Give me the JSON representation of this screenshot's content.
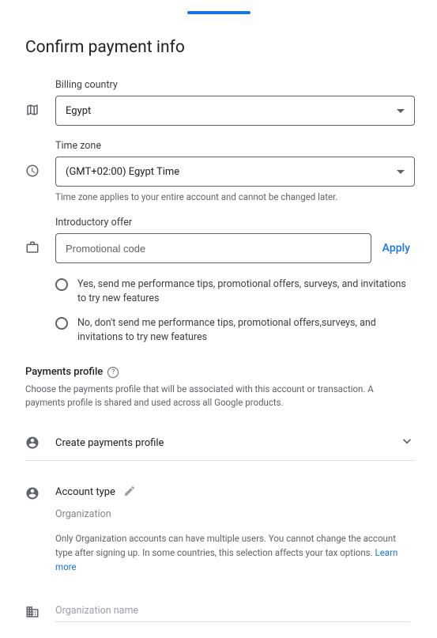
{
  "page": {
    "title": "Confirm payment info"
  },
  "billing": {
    "label": "Billing country",
    "value": "Egypt"
  },
  "timezone": {
    "label": "Time zone",
    "value": "(GMT+02:00) Egypt Time",
    "helper": "Time zone applies to your entire account and cannot be changed later."
  },
  "offer": {
    "label": "Introductory offer",
    "placeholder": "Promotional code",
    "apply": "Apply"
  },
  "radios": {
    "yes": "Yes, send me performance tips, promotional offers, surveys, and invitations to try new features",
    "no": "No, don't send me performance tips, promotional offers,surveys, and invitations to try new features"
  },
  "payments": {
    "title": "Payments profile",
    "desc": "Choose the payments profile that will be associated with this account or transaction. A payments profile is shared and used across all Google products.",
    "create": "Create payments profile"
  },
  "account": {
    "label": "Account type",
    "value": "Organization",
    "desc": "Only Organization accounts can have multiple users. You cannot change the account type after signing up. In some countries, this selection affects your tax options. ",
    "learn": "Learn more"
  },
  "org": {
    "label": "Organization name"
  }
}
